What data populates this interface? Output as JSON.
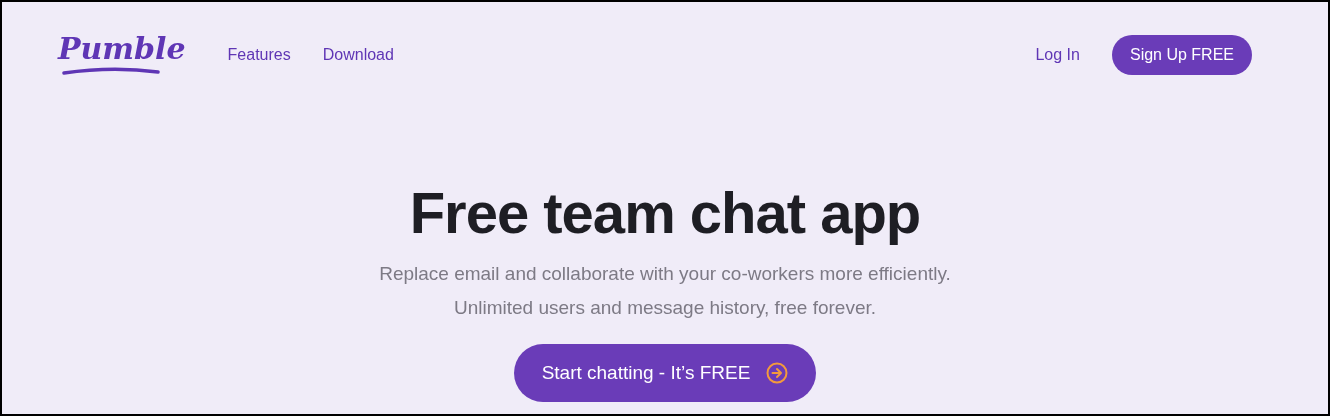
{
  "header": {
    "logo": "Pumble",
    "nav": [
      "Features",
      "Download"
    ],
    "login": "Log In",
    "signup": "Sign Up FREE"
  },
  "hero": {
    "title": "Free team chat app",
    "lines": [
      "Replace email and collaborate with your co-workers more efficiently.",
      "Unlimited users and message history, free forever."
    ],
    "cta": "Start chatting - It’s FREE"
  }
}
